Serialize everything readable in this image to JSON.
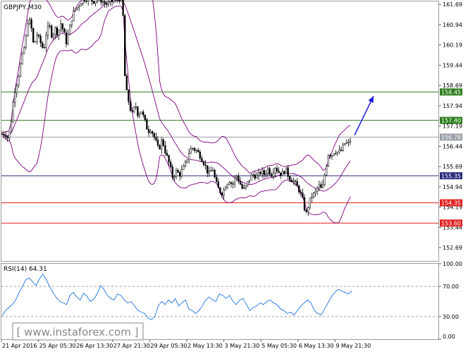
{
  "chart_data": [
    {
      "type": "candlestick",
      "title": "GBPJPY,M30",
      "xlabel": "",
      "ylabel": "",
      "ylim": [
        152.2,
        161.8
      ],
      "y_ticks": [
        "161.69",
        "160.94",
        "160.19",
        "159.44",
        "158.69",
        "157.94",
        "157.19",
        "156.44",
        "155.69",
        "154.94",
        "154.19",
        "153.44",
        "152.69"
      ],
      "x_ticks": [
        "21 Apr 2016",
        "25 Apr 05:30",
        "26 Apr 13:30",
        "27 Apr 21:30",
        "29 Apr 05:30",
        "2 May 13:30",
        "3 May 21:30",
        "5 May 05:30",
        "6 May 13:30",
        "9 May 21:30"
      ],
      "close_path": [
        [
          0,
          156.9
        ],
        [
          8,
          156.9
        ],
        [
          12,
          156.7
        ],
        [
          16,
          157.4
        ],
        [
          20,
          158.4
        ],
        [
          25,
          158.9
        ],
        [
          30,
          159.6
        ],
        [
          33,
          159.9
        ],
        [
          37,
          160.5
        ],
        [
          40,
          161.2
        ],
        [
          44,
          160.9
        ],
        [
          48,
          160.1
        ],
        [
          52,
          160.6
        ],
        [
          57,
          160.3
        ],
        [
          62,
          160.0
        ],
        [
          66,
          160.7
        ],
        [
          70,
          160.9
        ],
        [
          74,
          160.5
        ],
        [
          78,
          160.8
        ],
        [
          82,
          160.6
        ],
        [
          86,
          161.0
        ],
        [
          90,
          160.7
        ],
        [
          94,
          160.3
        ],
        [
          98,
          160.7
        ],
        [
          102,
          161.2
        ],
        [
          106,
          161.5
        ],
        [
          110,
          161.6
        ],
        [
          115,
          161.8
        ],
        [
          120,
          161.9
        ],
        [
          126,
          161.95
        ],
        [
          132,
          161.8
        ],
        [
          138,
          161.9
        ],
        [
          144,
          161.85
        ],
        [
          150,
          161.7
        ],
        [
          156,
          161.75
        ],
        [
          162,
          161.85
        ],
        [
          168,
          161.9
        ],
        [
          174,
          161.9
        ],
        [
          176,
          159.7
        ],
        [
          178,
          158.6
        ],
        [
          181,
          158.3
        ],
        [
          184,
          157.9
        ],
        [
          188,
          157.6
        ],
        [
          192,
          158.0
        ],
        [
          196,
          157.6
        ],
        [
          200,
          157.8
        ],
        [
          205,
          157.4
        ],
        [
          210,
          157.0
        ],
        [
          214,
          157.1
        ],
        [
          220,
          156.7
        ],
        [
          225,
          156.3
        ],
        [
          230,
          156.7
        ],
        [
          235,
          156.2
        ],
        [
          240,
          155.8
        ],
        [
          245,
          155.3
        ],
        [
          250,
          155.5
        ],
        [
          255,
          155.4
        ],
        [
          262,
          155.7
        ],
        [
          268,
          156.2
        ],
        [
          272,
          156.4
        ],
        [
          278,
          156.3
        ],
        [
          284,
          156.1
        ],
        [
          290,
          155.8
        ],
        [
          296,
          155.4
        ],
        [
          302,
          155.6
        ],
        [
          306,
          155.1
        ],
        [
          311,
          154.8
        ],
        [
          316,
          154.7
        ],
        [
          320,
          155.0
        ],
        [
          325,
          155.2
        ],
        [
          330,
          155.0
        ],
        [
          335,
          155.4
        ],
        [
          340,
          155.1
        ],
        [
          345,
          154.8
        ],
        [
          350,
          155.0
        ],
        [
          355,
          155.3
        ],
        [
          360,
          155.4
        ],
        [
          365,
          155.3
        ],
        [
          370,
          155.5
        ],
        [
          375,
          155.4
        ],
        [
          380,
          155.6
        ],
        [
          385,
          155.4
        ],
        [
          390,
          155.7
        ],
        [
          395,
          155.5
        ],
        [
          400,
          155.4
        ],
        [
          405,
          155.6
        ],
        [
          410,
          155.3
        ],
        [
          415,
          155.2
        ],
        [
          420,
          155.0
        ],
        [
          425,
          154.8
        ],
        [
          430,
          154.4
        ],
        [
          434,
          153.9
        ],
        [
          438,
          154.3
        ],
        [
          442,
          154.6
        ],
        [
          447,
          154.7
        ],
        [
          452,
          155.0
        ],
        [
          457,
          154.8
        ],
        [
          462,
          155.6
        ],
        [
          466,
          156.2
        ],
        [
          470,
          156.1
        ],
        [
          475,
          156.3
        ],
        [
          480,
          156.2
        ],
        [
          485,
          156.3
        ],
        [
          490,
          156.6
        ],
        [
          494,
          156.5
        ],
        [
          499,
          156.8
        ]
      ],
      "levels": [
        {
          "value": 158.45,
          "label": "158.45",
          "color": "#2e7d1e"
        },
        {
          "value": 157.4,
          "label": "157.40",
          "color": "#2e7d1e"
        },
        {
          "value": 156.78,
          "label": "156.78",
          "color": "#9aa0a6"
        },
        {
          "value": 155.35,
          "label": "155.35",
          "color": "#2d2a7a"
        },
        {
          "value": 154.35,
          "label": "154.35",
          "color": "#e02020"
        },
        {
          "value": 153.6,
          "label": "153.60",
          "color": "#e02020"
        }
      ],
      "projection": {
        "from": [
          503,
          156.85
        ],
        "to": [
          530,
          158.3
        ],
        "color": "#1a1adf"
      },
      "series": [
        {
          "name": "",
          "indicator": "bollinger",
          "color": "#800080"
        }
      ]
    },
    {
      "type": "line",
      "title": "RSI(14) 64.31",
      "ylim": [
        0,
        100
      ],
      "y_ticks": [
        "100.00",
        "70.00",
        "30.00",
        "0.00"
      ],
      "levels": [
        70,
        30
      ],
      "series": [
        {
          "name": "",
          "color": "#1e73e6",
          "values": [
            31,
            38,
            42,
            46,
            52,
            62,
            70,
            79,
            81,
            76,
            71,
            80,
            86,
            79,
            70,
            62,
            55,
            50,
            48,
            46,
            58,
            62,
            56,
            52,
            61,
            57,
            50,
            53,
            60,
            71,
            66,
            58,
            54,
            52,
            60,
            58,
            52,
            48,
            50,
            44,
            38,
            36,
            34,
            28,
            26,
            30,
            44,
            50,
            46,
            52,
            48,
            54,
            44,
            48,
            52,
            40,
            38,
            34,
            38,
            44,
            52,
            56,
            52,
            50,
            60,
            58,
            54,
            58,
            50,
            46,
            52,
            54,
            46,
            38,
            42,
            44,
            48,
            46,
            50,
            52,
            48,
            46,
            40,
            38,
            34,
            36,
            32,
            38,
            44,
            48,
            52,
            48,
            38,
            34,
            32,
            40,
            48,
            56,
            62,
            66,
            64,
            62,
            60,
            64
          ]
        }
      ]
    }
  ],
  "watermark": "[ www.instaforex.com ]"
}
